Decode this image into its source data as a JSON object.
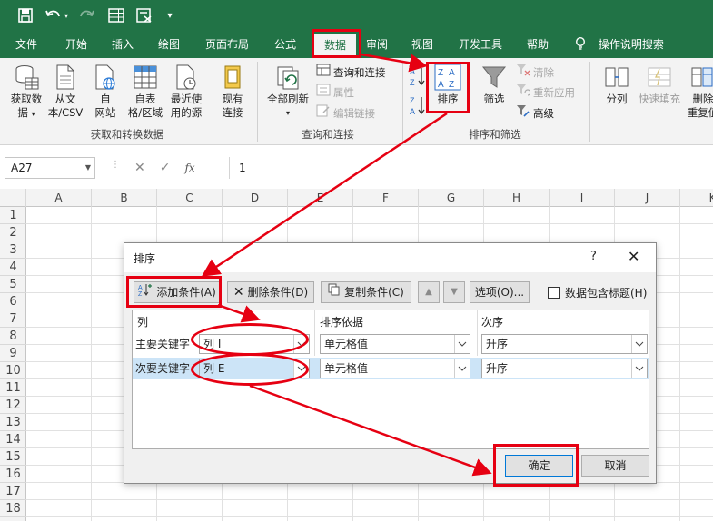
{
  "colors": {
    "excel_green": "#217346",
    "ribbon_bg": "#f3f3f3",
    "annotation_red": "#e60012",
    "selection_blue": "#cce4f7"
  },
  "qat": {
    "icons": [
      "save-icon",
      "undo-icon",
      "redo-icon",
      "table-icon",
      "custom-icon",
      "more-icon"
    ]
  },
  "tabs": [
    "文件",
    "开始",
    "插入",
    "绘图",
    "页面布局",
    "公式",
    "数据",
    "审阅",
    "视图",
    "开发工具",
    "帮助"
  ],
  "active_tab": "数据",
  "tell_me": "操作说明搜索",
  "ribbon": {
    "get_data": {
      "label": "获取数",
      "label2": "据"
    },
    "from_csv": {
      "label": "从文",
      "label2": "本/CSV"
    },
    "from_web": {
      "label": "自",
      "label2": "网站"
    },
    "from_table": {
      "label": "自表",
      "label2": "格/区域"
    },
    "recent_sources": {
      "label": "最近使",
      "label2": "用的源"
    },
    "existing_conn": {
      "label": "现有",
      "label2": "连接"
    },
    "group1": "获取和转换数据",
    "refresh_all": "全部刷新",
    "queries_conn": "查询和连接",
    "properties": "属性",
    "edit_links": "编辑链接",
    "group2": "查询和连接",
    "sort_asc": "A↓Z",
    "sort": "排序",
    "filter": "筛选",
    "clear": "清除",
    "reapply": "重新应用",
    "advanced": "高级",
    "group3": "排序和筛选",
    "text_to_columns": "分列",
    "flash_fill": "快速填充",
    "remove_dup": {
      "label": "删除",
      "label2": "重复值"
    }
  },
  "formula_bar": {
    "name_box": "A27",
    "formula": "1",
    "fx": "fx"
  },
  "grid": {
    "columns": [
      "A",
      "B",
      "C",
      "D",
      "E",
      "F",
      "G",
      "H",
      "I",
      "J",
      "K"
    ],
    "rows": [
      "1",
      "2",
      "3",
      "4",
      "5",
      "6",
      "7",
      "8",
      "9",
      "10",
      "11",
      "12",
      "13",
      "14",
      "15",
      "16",
      "17",
      "18"
    ]
  },
  "dialog": {
    "title": "排序",
    "help": "?",
    "close": "✕",
    "add_condition": "添加条件(A)",
    "delete_condition": "删除条件(D)",
    "copy_condition": "复制条件(C)",
    "options": "选项(O)...",
    "has_headers": "数据包含标题(H)",
    "header_column": "列",
    "header_sort_on": "排序依据",
    "header_order": "次序",
    "rows": [
      {
        "keyword": "主要关键字",
        "column": "列 I",
        "sort_on": "单元格值",
        "order": "升序"
      },
      {
        "keyword": "次要关键字",
        "column": "列 E",
        "sort_on": "单元格值",
        "order": "升序"
      }
    ],
    "ok": "确定",
    "cancel": "取消"
  }
}
